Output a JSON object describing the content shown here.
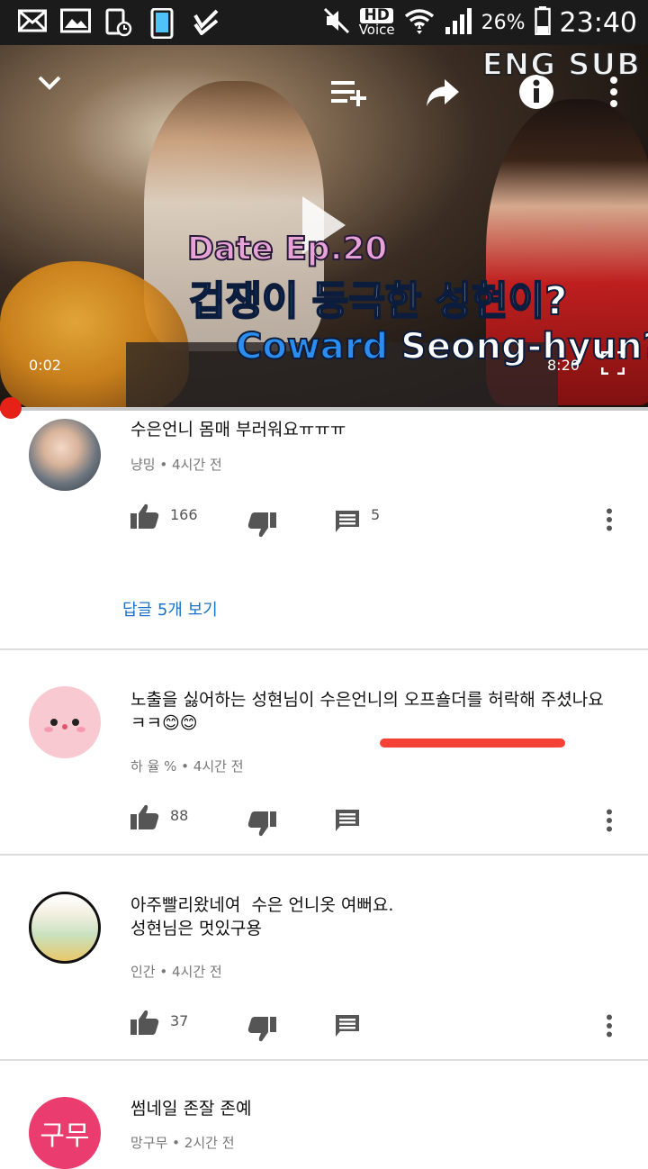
{
  "status_bar": {
    "hd_label": "HD",
    "voice_label": "Voice",
    "battery_percent": "26%",
    "time": "23:40"
  },
  "player": {
    "eng_sub": "ENG SUB",
    "title_line1": "Date Ep.20",
    "title_line2_a": "겁쟁이",
    "title_line2_b": "등극한 성현이?",
    "title_line3_a": "Coward",
    "title_line3_b": "Seong-hyun?",
    "current_time": "0:02",
    "duration": "8:20",
    "progress_fraction": 0.004
  },
  "comments": [
    {
      "text": "수은언니 몸매 부러워요ㅠㅠㅠ",
      "author": "냥밍",
      "time": "4시간 전",
      "likes": "166",
      "replies_count": "5",
      "view_replies": "답글 5개 보기"
    },
    {
      "text_line1": "노출을 싫어하는 성현님이 수은언니의 오프숄더를 허락해 주셨나요",
      "text_line2": "ㅋㅋ😊😊",
      "author": "하 율 %",
      "time": "4시간 전",
      "likes": "88"
    },
    {
      "text_line1": "아주빨리왔네여  수은 언니옷 여뻐요.",
      "text_line2": "성현님은 멋있구용",
      "author": "인간",
      "time": "4시간 전",
      "likes": "37"
    },
    {
      "text": "썸네일 존잘 존예",
      "author": "망구무",
      "time": "2시간 전",
      "avatar_text": "구무"
    }
  ]
}
